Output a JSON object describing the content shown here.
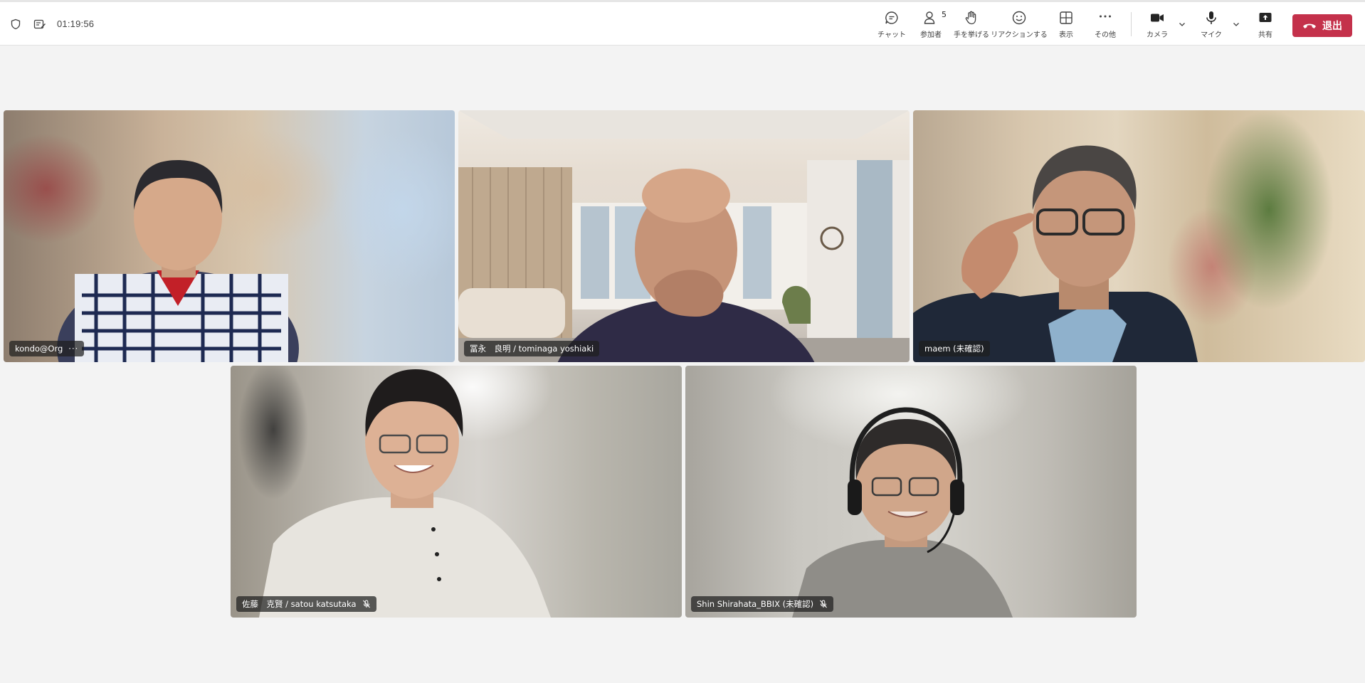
{
  "header": {
    "timer": "01:19:56",
    "icons": [
      "shield-icon",
      "notes-icon"
    ]
  },
  "toolbar": {
    "chat": "チャット",
    "participants": "参加者",
    "participants_count": "5",
    "raise_hand": "手を挙げる",
    "react": "リアクションする",
    "view": "表示",
    "more": "その他",
    "camera": "カメラ",
    "mic": "マイク",
    "share": "共有",
    "leave": "退出"
  },
  "colors": {
    "leave": "#c4314b",
    "background": "#f3f3f3"
  },
  "participants": [
    {
      "name": "kondo@Org",
      "has_more": true,
      "muted": false
    },
    {
      "name": "冨永　良明 / tominaga yoshiaki",
      "muted": false
    },
    {
      "name": "maem (未確認)",
      "muted": false
    },
    {
      "name": "佐藤　克賢 / satou katsutaka",
      "muted": true
    },
    {
      "name": "Shin Shirahata_BBIX (未確認)",
      "muted": true
    }
  ]
}
